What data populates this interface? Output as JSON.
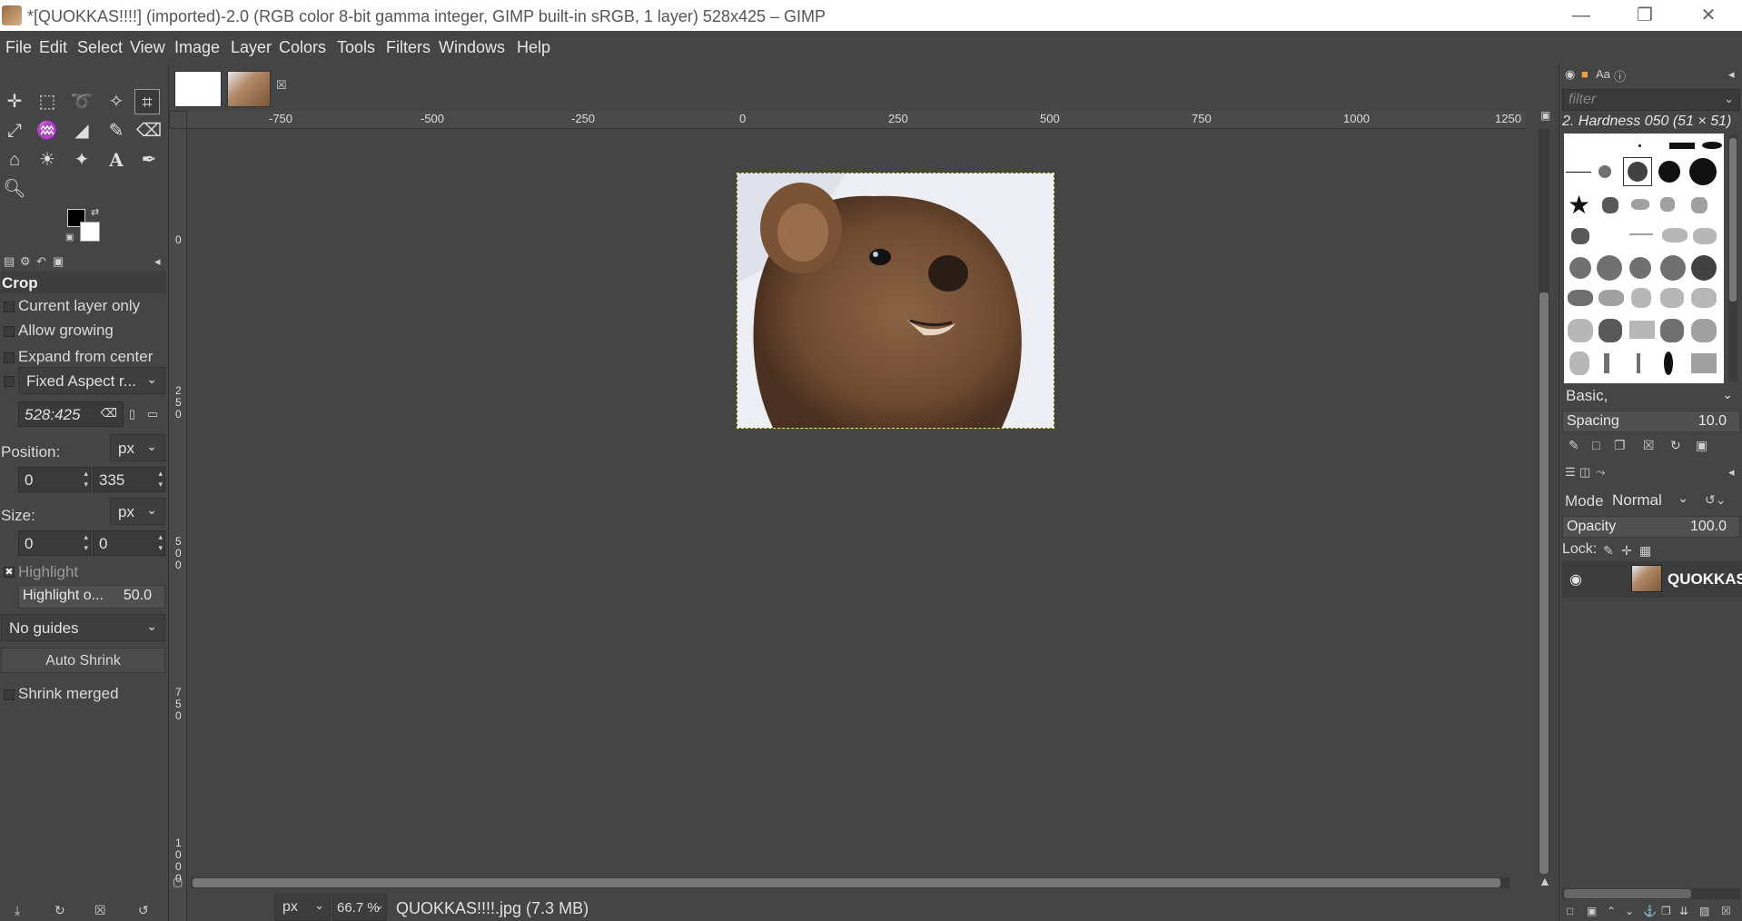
{
  "window": {
    "title": "*[QUOKKAS!!!!] (imported)-2.0 (RGB color 8-bit gamma integer, GIMP built-in sRGB, 1 layer) 528x425 – GIMP",
    "minimize_icon": "minimize-icon",
    "restore_icon": "restore-icon",
    "close_icon": "close-icon"
  },
  "menu": [
    "File",
    "Edit",
    "Select",
    "View",
    "Image",
    "Layer",
    "Colors",
    "Tools",
    "Filters",
    "Windows",
    "Help"
  ],
  "tool_options": {
    "title": "Crop",
    "current_layer_only": "Current layer only",
    "allow_growing": "Allow growing",
    "expand_from_center": "Expand from center",
    "fixed_aspect": "Fixed Aspect r...",
    "aspect_value": "528:425",
    "position_label": "Position:",
    "position_unit": "px",
    "position_x": "0",
    "position_y": "335",
    "size_label": "Size:",
    "size_unit": "px",
    "size_w": "0",
    "size_h": "0",
    "highlight": "Highlight",
    "highlight_opacity_label": "Highlight o...",
    "highlight_opacity_value": "50.0",
    "guides": "No guides",
    "auto_shrink": "Auto Shrink",
    "shrink_merged": "Shrink merged"
  },
  "rulers": {
    "h_ticks": [
      "-750",
      "-500",
      "-250",
      "0",
      "250",
      "500",
      "750",
      "1000",
      "1250"
    ],
    "v_ticks": [
      "0",
      "250",
      "500",
      "750",
      "1000"
    ]
  },
  "status": {
    "unit": "px",
    "zoom": "66.7 %",
    "file": "QUOKKAS!!!!.jpg (7.3 MB)"
  },
  "brushes": {
    "filter_placeholder": "filter",
    "selected": "2. Hardness 050 (51 × 51)",
    "preset": "Basic,",
    "spacing_label": "Spacing",
    "spacing_value": "10.0"
  },
  "layers": {
    "mode_label": "Mode",
    "mode_value": "Normal",
    "opacity_label": "Opacity",
    "opacity_value": "100.0",
    "lock_label": "Lock:",
    "layer_name": "QUOKKAS"
  }
}
